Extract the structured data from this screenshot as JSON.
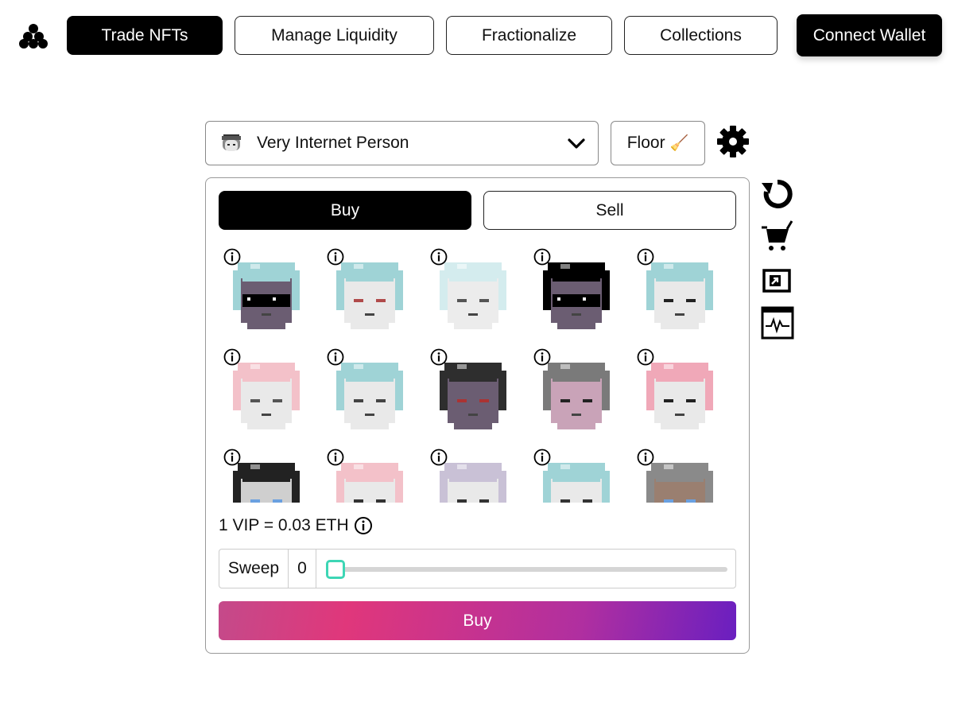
{
  "nav": {
    "trade": "Trade NFTs",
    "liquidity": "Manage Liquidity",
    "fractionalize": "Fractionalize",
    "collections": "Collections",
    "wallet": "Connect Wallet"
  },
  "collection": {
    "name": "Very Internet Person",
    "floor_label": "Floor",
    "floor_emoji": "🧹"
  },
  "tabs": {
    "buy": "Buy",
    "sell": "Sell"
  },
  "price_text": "1 VIP = 0.03 ETH",
  "sweep": {
    "label": "Sweep",
    "count": "0"
  },
  "buy_button": "Buy",
  "colors": {
    "accent_black": "#000000",
    "slider_thumb": "#3dd6b5",
    "gradient_start": "#c44a8a",
    "gradient_mid": "#e0377b",
    "gradient_end": "#6a1fc0"
  },
  "icons": [
    "logo-icon",
    "chevron-down-icon",
    "gear-icon",
    "refresh-icon",
    "cart-icon",
    "external-link-icon",
    "activity-icon",
    "info-icon"
  ],
  "nfts": [
    {
      "hair": "#9fd3d6",
      "face": "#6b5d72",
      "shade": "#000000",
      "glasses": true
    },
    {
      "hair": "#9fd3d6",
      "face": "#e9e9e9",
      "shade": "#b04a4a",
      "glasses": false
    },
    {
      "hair": "#d4ecee",
      "face": "#ececec",
      "shade": "#555555",
      "glasses": false
    },
    {
      "hair": "#000000",
      "face": "#6b5d72",
      "shade": "#000000",
      "glasses": true
    },
    {
      "hair": "#9fd3d6",
      "face": "#e9e9e9",
      "shade": "#222222",
      "glasses": false
    },
    {
      "hair": "#f3c1c9",
      "face": "#e9e9e9",
      "shade": "#555555",
      "glasses": false
    },
    {
      "hair": "#9fd3d6",
      "face": "#e9e9e9",
      "shade": "#444444",
      "glasses": false
    },
    {
      "hair": "#2e2e2e",
      "face": "#6b5d72",
      "shade": "#a33",
      "glasses": false
    },
    {
      "hair": "#7a7a7a",
      "face": "#c9a3b8",
      "shade": "#222222",
      "glasses": false
    },
    {
      "hair": "#f0a8b8",
      "face": "#e9e9e9",
      "shade": "#222222",
      "glasses": false
    },
    {
      "hair": "#222222",
      "face": "#cfcfcf",
      "shade": "#6aa0e0",
      "glasses": false
    },
    {
      "hair": "#f3c1c9",
      "face": "#e9e9e9",
      "shade": "#333333",
      "glasses": false
    },
    {
      "hair": "#c9c1d6",
      "face": "#e9e9e9",
      "shade": "#333333",
      "glasses": false
    },
    {
      "hair": "#9fd3d6",
      "face": "#e9e9e9",
      "shade": "#333333",
      "glasses": false
    },
    {
      "hair": "#8a8a8a",
      "face": "#9a7f70",
      "shade": "#6aa0e0",
      "glasses": false
    }
  ]
}
